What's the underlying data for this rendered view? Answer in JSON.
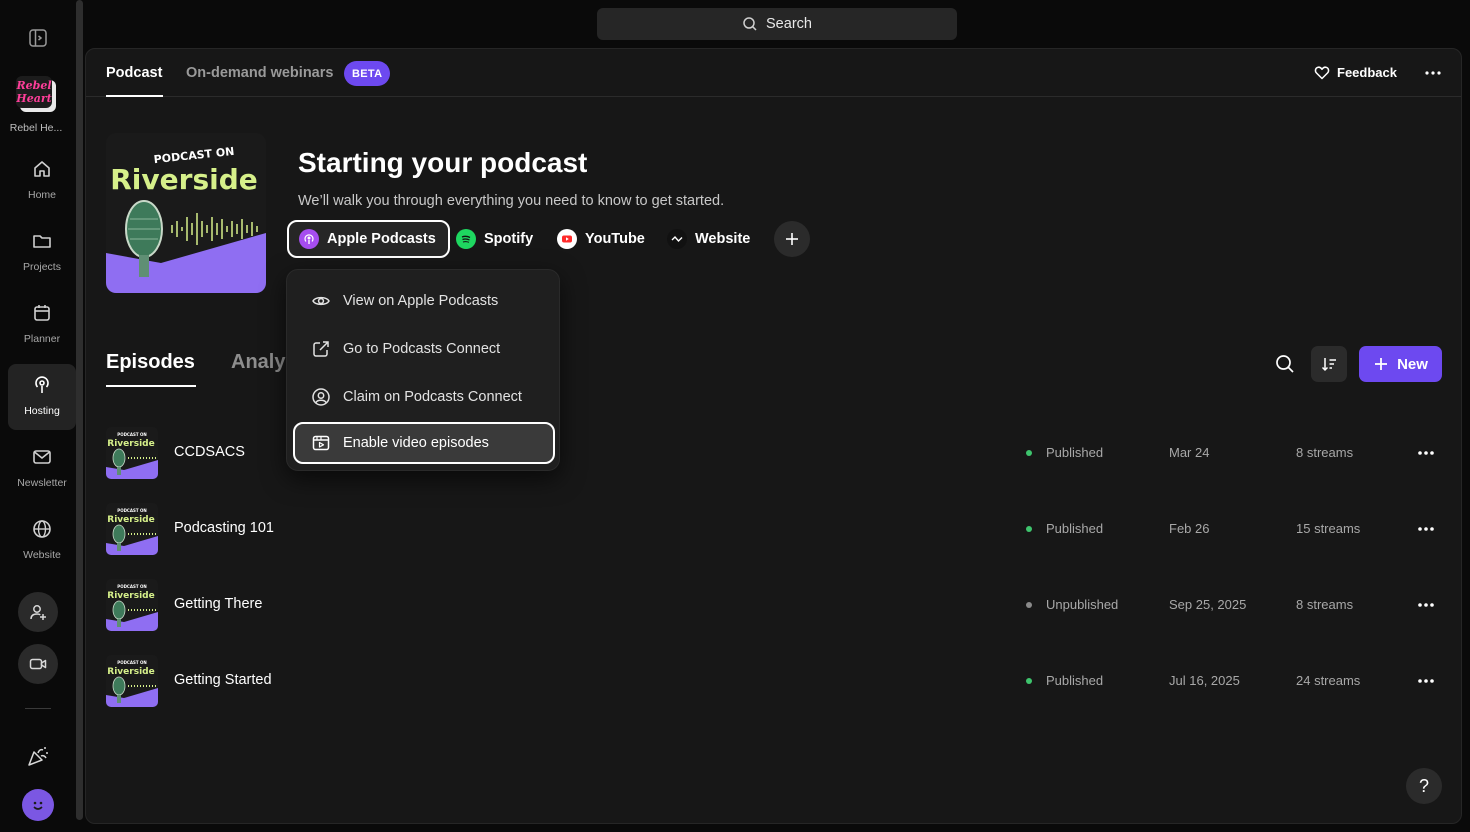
{
  "colors": {
    "accent": "#6d49f0",
    "published": "#3ec46d",
    "unpublished": "#8a8a8a",
    "cover_bg": "#1a1a1a",
    "cover_purple": "#8f6ef2",
    "cover_text": "#d6f08a"
  },
  "sidebar": {
    "brand_label": "Rebel He...",
    "brand_logo_text": "Rebel Heart",
    "items": [
      {
        "label": "Home",
        "icon": "home-icon"
      },
      {
        "label": "Projects",
        "icon": "folder-icon"
      },
      {
        "label": "Planner",
        "icon": "calendar-icon"
      },
      {
        "label": "Hosting",
        "icon": "podcast-icon",
        "active": true
      },
      {
        "label": "Newsletter",
        "icon": "mail-icon"
      },
      {
        "label": "Website",
        "icon": "globe-icon"
      }
    ]
  },
  "search": {
    "label": "Search"
  },
  "header": {
    "tabs": [
      {
        "label": "Podcast",
        "active": true
      },
      {
        "label": "On-demand webinars"
      }
    ],
    "beta_badge": "BETA",
    "feedback_label": "Feedback"
  },
  "podcast": {
    "cover_line1": "PODCAST ON",
    "cover_line2": "Riverside",
    "title": "Starting your podcast",
    "subtitle": "We’ll walk you through everything you need to know to get started.",
    "platforms": [
      {
        "label": "Apple Podcasts",
        "icon": "apple-podcasts-icon",
        "selected": true
      },
      {
        "label": "Spotify",
        "icon": "spotify-icon"
      },
      {
        "label": "YouTube",
        "icon": "youtube-icon"
      },
      {
        "label": "Website",
        "icon": "website-icon"
      }
    ]
  },
  "menu": {
    "items": [
      {
        "label": "View on Apple Podcasts",
        "icon": "eye-icon"
      },
      {
        "label": "Go to Podcasts Connect",
        "icon": "external-link-icon"
      },
      {
        "label": "Claim on Podcasts Connect",
        "icon": "user-circle-icon"
      },
      {
        "label": "Enable video episodes",
        "icon": "video-frame-icon",
        "highlighted": true
      }
    ]
  },
  "episodes": {
    "tabs": [
      {
        "label": "Episodes",
        "active": true
      },
      {
        "label": "Analy"
      }
    ],
    "new_label": "New",
    "rows": [
      {
        "title": "CCDSACS",
        "status": "Published",
        "date": "Mar 24",
        "streams": "8 streams"
      },
      {
        "title": "Podcasting 101",
        "status": "Published",
        "date": "Feb 26",
        "streams": "15 streams"
      },
      {
        "title": "Getting There",
        "status": "Unpublished",
        "date": "Sep 25, 2025",
        "streams": "8 streams"
      },
      {
        "title": "Getting Started",
        "status": "Published",
        "date": "Jul 16, 2025",
        "streams": "24 streams"
      }
    ]
  },
  "help_label": "?"
}
